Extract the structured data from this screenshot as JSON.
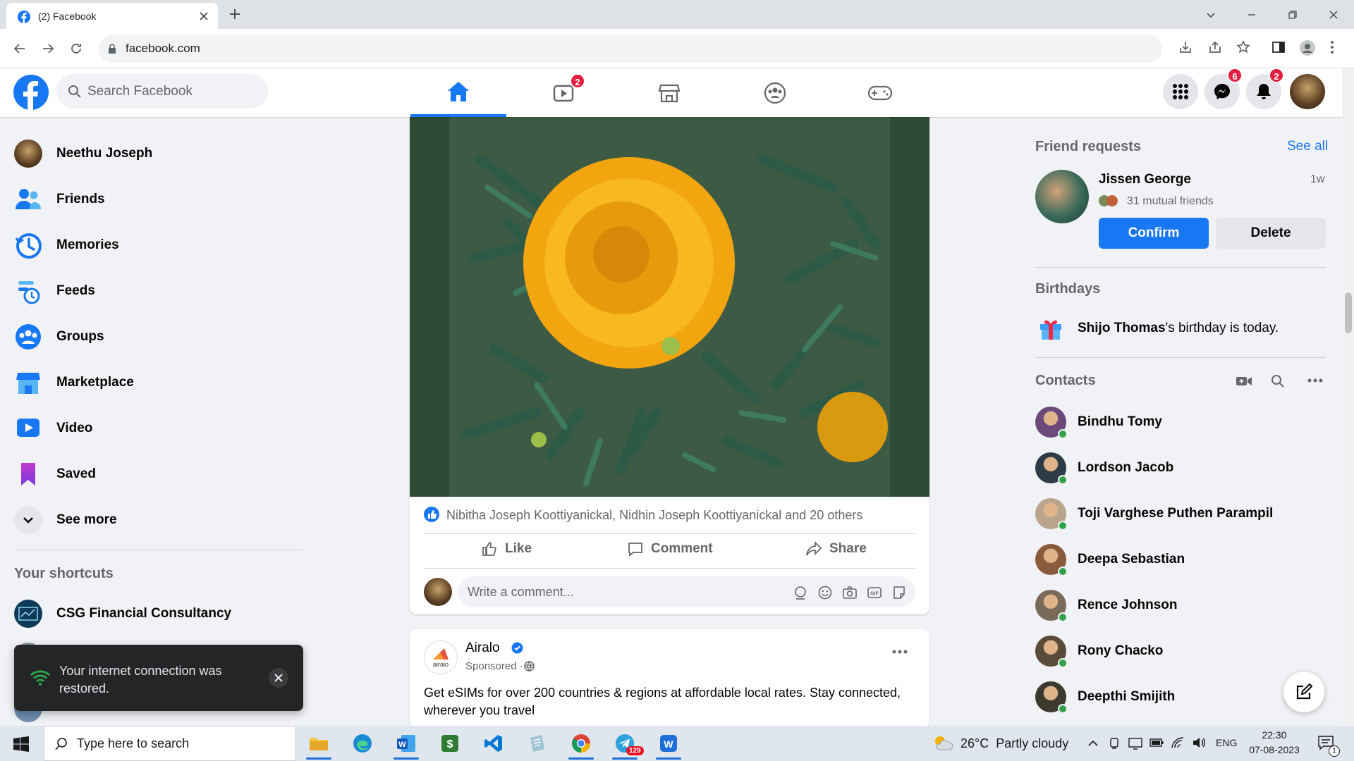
{
  "browser": {
    "tab_title": "(2) Facebook",
    "url": "facebook.com"
  },
  "fb_header": {
    "search_placeholder": "Search Facebook",
    "watch_badge": "2",
    "messenger_badge": "6",
    "notifications_badge": "2"
  },
  "left_nav": {
    "items": [
      {
        "label": "Neethu Joseph",
        "icon": "profile-avatar"
      },
      {
        "label": "Friends",
        "icon": "friends-icon"
      },
      {
        "label": "Memories",
        "icon": "memories-icon"
      },
      {
        "label": "Feeds",
        "icon": "feeds-icon"
      },
      {
        "label": "Groups",
        "icon": "groups-icon"
      },
      {
        "label": "Marketplace",
        "icon": "marketplace-icon"
      },
      {
        "label": "Video",
        "icon": "video-icon"
      },
      {
        "label": "Saved",
        "icon": "saved-icon"
      },
      {
        "label": "See more",
        "icon": "chevron-down-icon"
      }
    ],
    "shortcuts_title": "Your shortcuts",
    "shortcuts": [
      {
        "label": "CSG Financial Consultancy"
      }
    ]
  },
  "post": {
    "reactions_text": "Nibitha Joseph Koottiyanickal, Nidhin Joseph Koottiyanickal and 20 others",
    "like_label": "Like",
    "comment_label": "Comment",
    "share_label": "Share",
    "comment_placeholder": "Write a comment..."
  },
  "sponsored_post": {
    "author": "Airalo",
    "meta": "Sponsored ·",
    "logo_text": "airalo",
    "body": "Get eSIMs for over 200 countries & regions at affordable local rates. Stay connected, wherever you travel"
  },
  "right_col": {
    "friend_requests_title": "Friend requests",
    "see_all": "See all",
    "request": {
      "name": "Jissen George",
      "age": "1w",
      "mutual": "31 mutual friends",
      "confirm": "Confirm",
      "delete": "Delete"
    },
    "birthdays_title": "Birthdays",
    "birthday_name": "Shijo Thomas",
    "birthday_rest": "'s birthday is today.",
    "contacts_title": "Contacts",
    "contacts": [
      {
        "name": "Bindhu Tomy",
        "color": "#6b4a7a"
      },
      {
        "name": "Lordson Jacob",
        "color": "#2c3b46"
      },
      {
        "name": "Toji Varghese Puthen Parampil",
        "color": "#b8a58c"
      },
      {
        "name": "Deepa Sebastian",
        "color": "#8a5a3c"
      },
      {
        "name": "Rence Johnson",
        "color": "#7a6a5a"
      },
      {
        "name": "Rony Chacko",
        "color": "#5a4a3a"
      },
      {
        "name": "Deepthi Smijith",
        "color": "#3c3a2e"
      }
    ]
  },
  "toast": {
    "message": "Your internet connection was restored."
  },
  "taskbar": {
    "search_placeholder": "Type here to search",
    "weather": "26°C  Partly cloudy",
    "lang": "ENG",
    "time": "22:30",
    "date": "07-08-2023",
    "telegram_badge": "129",
    "notif_count": "1"
  },
  "colors": {
    "fb_blue": "#1877f2",
    "badge_red": "#e41e3f",
    "online_green": "#31a24c"
  }
}
